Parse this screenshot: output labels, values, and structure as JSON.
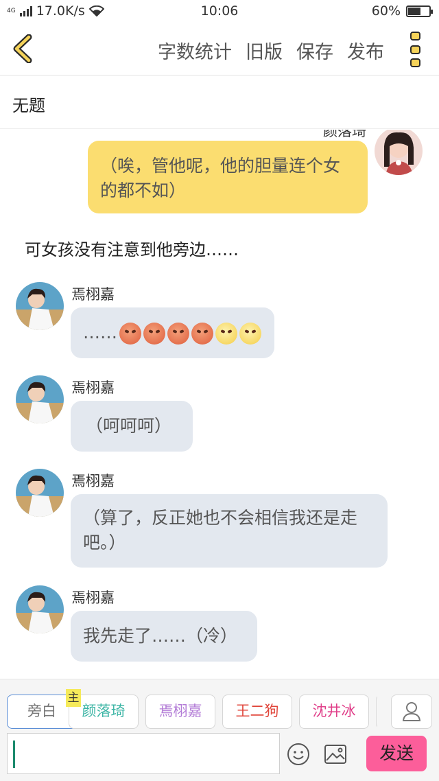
{
  "status_bar": {
    "network": "4G",
    "speed": "17.0K/s",
    "time": "10:06",
    "battery": "60%",
    "battery_level": 0.6
  },
  "toolbar": {
    "word_count": "字数统计",
    "old_version": "旧版",
    "save": "保存",
    "publish": "发布"
  },
  "title": "无题",
  "chat": {
    "top_partial_name": "颜落琦",
    "messages": [
      {
        "type": "right",
        "speaker": "颜落琦",
        "text": "（唉，管他呢，他的胆量连个女的都不如）"
      },
      {
        "type": "narration",
        "text": "可女孩没有注意到他旁边……"
      },
      {
        "type": "left",
        "speaker": "焉栩嘉",
        "text": "……"
      },
      {
        "type": "left",
        "speaker": "焉栩嘉",
        "text": "（呵呵呵）"
      },
      {
        "type": "left",
        "speaker": "焉栩嘉",
        "text": "（算了，反正她也不会相信我还是走吧。）"
      },
      {
        "type": "left",
        "speaker": "焉栩嘉",
        "text": "我先走了……（冷）"
      }
    ],
    "emoji_names": [
      "angry-face",
      "angry-face",
      "angry-face",
      "angry-face",
      "steam-face",
      "steam-face"
    ]
  },
  "characters": {
    "main_badge": "主",
    "items": [
      {
        "label": "旁白",
        "color": "#777777"
      },
      {
        "label": "颜落琦",
        "color": "#3cb5a5"
      },
      {
        "label": "焉栩嘉",
        "color": "#b27ad6"
      },
      {
        "label": "王二狗",
        "color": "#e0453a"
      },
      {
        "label": "沈井冰",
        "color": "#e0408a"
      }
    ]
  },
  "composer": {
    "input_value": "",
    "send": "发送",
    "emoji_icon": "smiley-icon",
    "image_icon": "image-icon"
  },
  "colors": {
    "right_bubble": "#fbdd70",
    "left_bubble": "#e3e8ef",
    "send_button": "#fc5e9a",
    "menu_dots": "#f5d35a"
  }
}
